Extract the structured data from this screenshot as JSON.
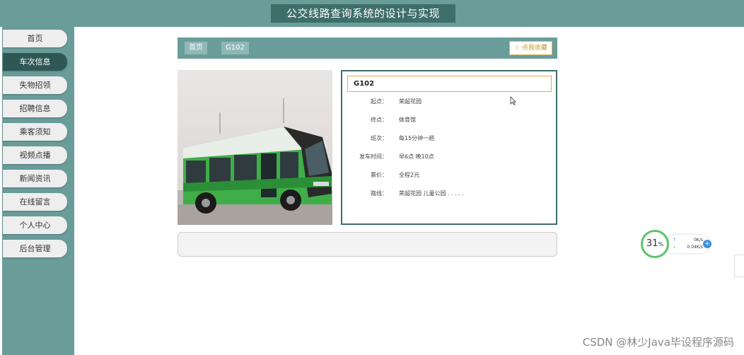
{
  "header": {
    "title": "公交线路查询系统的设计与实现"
  },
  "sidebar": {
    "items": [
      {
        "label": "首页",
        "active": false
      },
      {
        "label": "车次信息",
        "active": true
      },
      {
        "label": "失物招领",
        "active": false
      },
      {
        "label": "招聘信息",
        "active": false
      },
      {
        "label": "乘客须知",
        "active": false
      },
      {
        "label": "视频点播",
        "active": false
      },
      {
        "label": "新闻资讯",
        "active": false
      },
      {
        "label": "在线留言",
        "active": false
      },
      {
        "label": "个人中心",
        "active": false
      },
      {
        "label": "后台管理",
        "active": false
      }
    ]
  },
  "breadcrumb": {
    "home": "首页",
    "current": "G102",
    "favorite_label": "☆ 点我收藏"
  },
  "detail": {
    "title": "G102",
    "fields": [
      {
        "label": "起点：",
        "value": "荣超花园"
      },
      {
        "label": "终点：",
        "value": "体育馆"
      },
      {
        "label": "班次：",
        "value": "每15分钟一趟"
      },
      {
        "label": "发车时间：",
        "value": "早6点 晚10点"
      },
      {
        "label": "票价：",
        "value": "全程2元"
      },
      {
        "label": "路线：",
        "value": "荣超花园 儿童公园 . . . . ."
      }
    ]
  },
  "net_widget": {
    "percent": "31",
    "percent_unit": "%",
    "upload": "0K/s",
    "download": "0.04K/s"
  },
  "watermark": "CSDN @林少Java毕设程序源码",
  "colors": {
    "theme": "#6a9d9a",
    "theme_dark": "#3e6e6a",
    "active_nav": "#2f5754",
    "accent": "#e2b84a",
    "bus_green": "#3fae49"
  }
}
